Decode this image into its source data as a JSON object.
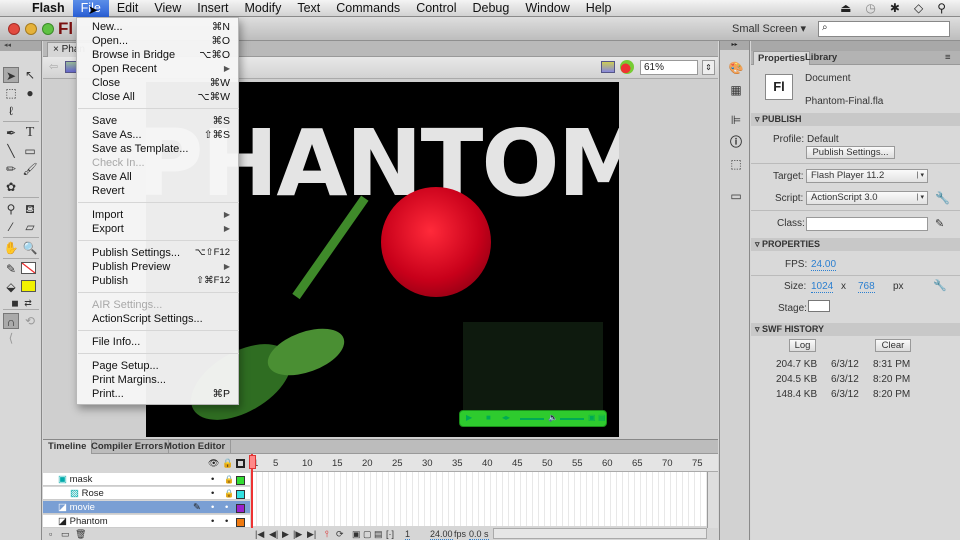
{
  "menubar": {
    "apple": "",
    "items": [
      "Flash",
      "File",
      "Edit",
      "View",
      "Insert",
      "Modify",
      "Text",
      "Commands",
      "Control",
      "Debug",
      "Window",
      "Help"
    ],
    "active": "File",
    "status_icons": [
      "eject-icon",
      "time-machine-icon",
      "bluetooth-icon",
      "wifi-icon",
      "spotlight-icon"
    ]
  },
  "appbar": {
    "logo": "Fl",
    "workspace": "Small Screen",
    "workspace_caret": "▾",
    "search_value": "",
    "search_icon": "⌕"
  },
  "document": {
    "tab_label": "Phantom-Final.fla",
    "tab_short": "Phan",
    "zoom": "61%",
    "stage_title": "PHANTOM"
  },
  "file_menu": {
    "items": [
      {
        "label": "New...",
        "shortcut": "⌘N"
      },
      {
        "label": "Open...",
        "shortcut": "⌘O"
      },
      {
        "label": "Browse in Bridge",
        "shortcut": "⌥⌘O"
      },
      {
        "label": "Open Recent",
        "shortcut": "▶"
      },
      {
        "label": "Close",
        "shortcut": "⌘W"
      },
      {
        "label": "Close All",
        "shortcut": "⌥⌘W"
      },
      {
        "label": "Save",
        "shortcut": "⌘S"
      },
      {
        "label": "Save As...",
        "shortcut": "⇧⌘S"
      },
      {
        "label": "Save as Template...",
        "shortcut": ""
      },
      {
        "label": "Check In...",
        "shortcut": "",
        "disabled": true
      },
      {
        "label": "Save All",
        "shortcut": ""
      },
      {
        "label": "Revert",
        "shortcut": ""
      },
      {
        "label": "Import",
        "shortcut": "▶"
      },
      {
        "label": "Export",
        "shortcut": "▶"
      },
      {
        "label": "Publish Settings...",
        "shortcut": "⌥⇧F12"
      },
      {
        "label": "Publish Preview",
        "shortcut": "▶"
      },
      {
        "label": "Publish",
        "shortcut": "⇧⌘F12"
      },
      {
        "label": "AIR Settings...",
        "shortcut": "",
        "disabled": true
      },
      {
        "label": "ActionScript Settings...",
        "shortcut": ""
      },
      {
        "label": "File Info...",
        "shortcut": ""
      },
      {
        "label": "Page Setup...",
        "shortcut": ""
      },
      {
        "label": "Print Margins...",
        "shortcut": ""
      },
      {
        "label": "Print...",
        "shortcut": "⌘P"
      }
    ]
  },
  "properties": {
    "tabs": [
      "Properties",
      "Library"
    ],
    "doc_icon": "Fl",
    "doc_type": "Document",
    "doc_name": "Phantom-Final.fla",
    "publish": {
      "header": "PUBLISH",
      "profile_label": "Profile:",
      "profile_value": "Default",
      "settings_button": "Publish Settings...",
      "target_label": "Target:",
      "target_value": "Flash Player 11.2",
      "script_label": "Script:",
      "script_value": "ActionScript 3.0",
      "class_label": "Class:",
      "class_value": ""
    },
    "props": {
      "header": "PROPERTIES",
      "fps_label": "FPS:",
      "fps_value": "24.00",
      "size_label": "Size:",
      "width": "1024",
      "x": "x",
      "height": "768",
      "unit": "px",
      "stage_label": "Stage:",
      "stage_color": "#ffffff"
    },
    "swf_history": {
      "header": "SWF HISTORY",
      "log_button": "Log",
      "clear_button": "Clear",
      "rows": [
        {
          "size": "204.7 KB",
          "date": "6/3/12",
          "time": "8:31 PM"
        },
        {
          "size": "204.5 KB",
          "date": "6/3/12",
          "time": "8:20 PM"
        },
        {
          "size": "148.4 KB",
          "date": "6/3/12",
          "time": "8:20 PM"
        }
      ]
    }
  },
  "timeline": {
    "tabs": [
      "Timeline",
      "Compiler Errors",
      "Motion Editor"
    ],
    "ruler": [
      "1",
      "5",
      "10",
      "15",
      "20",
      "25",
      "30",
      "35",
      "40",
      "45",
      "50",
      "55",
      "60",
      "65",
      "70",
      "75"
    ],
    "layers": [
      {
        "name": "mask",
        "color": "#33dd33",
        "selected": false
      },
      {
        "name": "Rose",
        "color": "#33e0e0",
        "selected": false
      },
      {
        "name": "movie",
        "color": "#9a22cc",
        "selected": true
      },
      {
        "name": "Phantom",
        "color": "#f07a10",
        "selected": false
      }
    ],
    "current_frame": "1",
    "fps": "24.00",
    "fps_unit": "fps",
    "elapsed": "0.0 s"
  }
}
